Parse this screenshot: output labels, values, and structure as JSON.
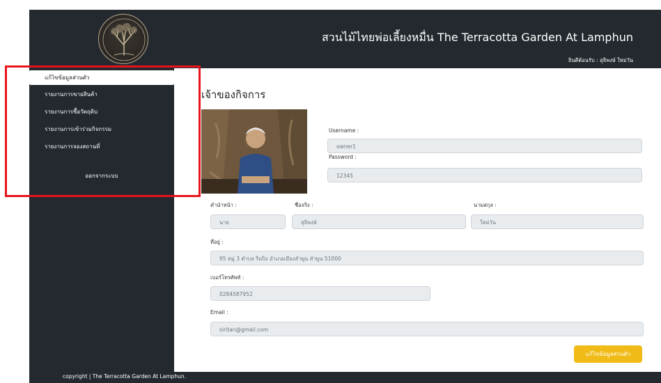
{
  "header": {
    "site_title": "สวนไม้ไทยพ่อเลี้ยงหมื่น The Terracotta Garden At Lamphun",
    "welcome": "ยินดีต้อนรับ :  สุธิพงษ์ ใหม่วัน"
  },
  "sidebar": {
    "items": [
      {
        "label": "แก้ไขข้อมูลส่วนตัว",
        "active": true
      },
      {
        "label": "รายงานการขายสินค้า",
        "active": false
      },
      {
        "label": "รายงานการซื้อวัตถุดิบ",
        "active": false
      },
      {
        "label": "รายงานการเข้าร่วมกิจกรรม",
        "active": false
      },
      {
        "label": "รายงานการจองสถานที่",
        "active": false
      }
    ],
    "logout": "ออกจากระบบ"
  },
  "main": {
    "heading": "เจ้าของกิจการ",
    "username_label": "Username :",
    "username_value": "owner1",
    "password_label": "Password :",
    "password_value": "12345",
    "prefix_label": "คำนำหน้า :",
    "prefix_value": "นาย",
    "firstname_label": "ชื่อจริง :",
    "firstname_value": "สุธิพงษ์",
    "lastname_label": "นามสกุล :",
    "lastname_value": "ใหม่วัน",
    "address_label": "ที่อยู่ :",
    "address_value": "95 หมู่ 3 ตำบล ริมปิง อำเภอเมืองลำพูน ลำพูน 51000",
    "phone_label": "เบอร์โทรศัพท์ :",
    "phone_value": "0284587952",
    "email_label": "Email :",
    "email_value": "siritan@gmail.com",
    "edit_button": "แก้ไขข้อมูลส่วนตัว"
  },
  "footer": {
    "copyright": "copyright | The Terracotta Garden At Lamphun."
  },
  "colors": {
    "dark": "#23292f",
    "accent": "#f0bb16",
    "highlight": "#e8141c",
    "field_bg": "#e9ecef"
  }
}
